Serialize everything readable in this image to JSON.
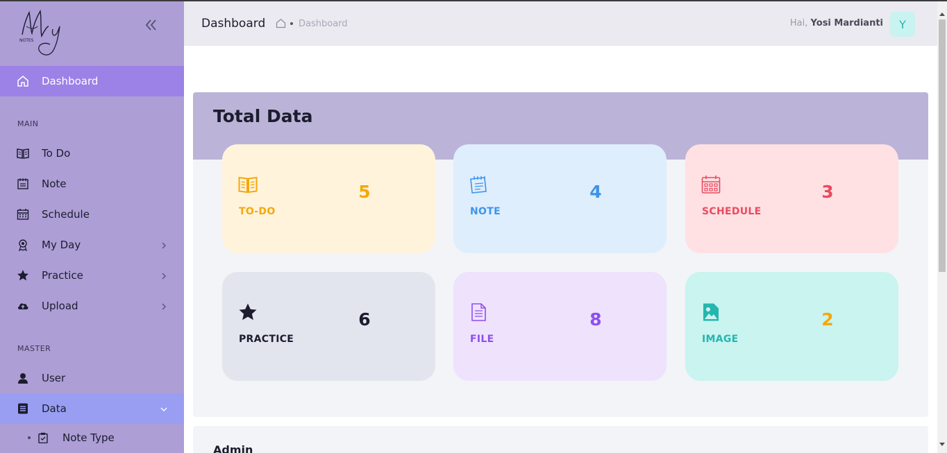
{
  "app": {
    "logo_text": "My NOTES"
  },
  "sidebar": {
    "dashboard_label": "Dashboard",
    "section_main": "MAIN",
    "section_master": "MASTER",
    "items": [
      {
        "label": "To Do",
        "icon": "book-icon"
      },
      {
        "label": "Note",
        "icon": "notepad-icon"
      },
      {
        "label": "Schedule",
        "icon": "calendar-icon"
      },
      {
        "label": "My Day",
        "icon": "award-icon",
        "has_submenu": true
      },
      {
        "label": "Practice",
        "icon": "star-icon",
        "has_submenu": true
      },
      {
        "label": "Upload",
        "icon": "cloud-upload-icon",
        "has_submenu": true
      },
      {
        "label": "User",
        "icon": "user-icon"
      },
      {
        "label": "Data",
        "icon": "list-icon",
        "has_submenu": true,
        "expanded": true
      }
    ],
    "sub_items": [
      {
        "label": "Note Type",
        "icon": "clipboard-icon"
      }
    ]
  },
  "header": {
    "title": "Dashboard",
    "breadcrumb": "Dashboard",
    "greeting": "Hai,",
    "user_name": "Yosi Mardianti",
    "avatar_letter": "Y"
  },
  "main": {
    "panel_title": "Total Data",
    "cards": [
      {
        "label": "TO-DO",
        "value": "5",
        "icon": "book-icon",
        "bg": "#fff3dc",
        "color": "#f5a80a"
      },
      {
        "label": "NOTE",
        "value": "4",
        "icon": "notepad-icon",
        "bg": "#deeefc",
        "color": "#3d94ea"
      },
      {
        "label": "SCHEDULE",
        "value": "3",
        "icon": "calendar-icon",
        "bg": "#ffe0e3",
        "color": "#ea4a5f"
      },
      {
        "label": "PRACTICE",
        "value": "6",
        "icon": "star-icon",
        "bg": "#e3e5ee",
        "color": "#1c1c2e"
      },
      {
        "label": "FILE",
        "value": "8",
        "icon": "file-icon",
        "bg": "#eee2fd",
        "color": "#8e4ef0"
      },
      {
        "label": "IMAGE",
        "value": "2",
        "icon": "image-icon",
        "bg": "#c9f4f0",
        "color": "#25b6ae",
        "value_color": "#f5a80a"
      }
    ],
    "admin_title": "Admin"
  }
}
